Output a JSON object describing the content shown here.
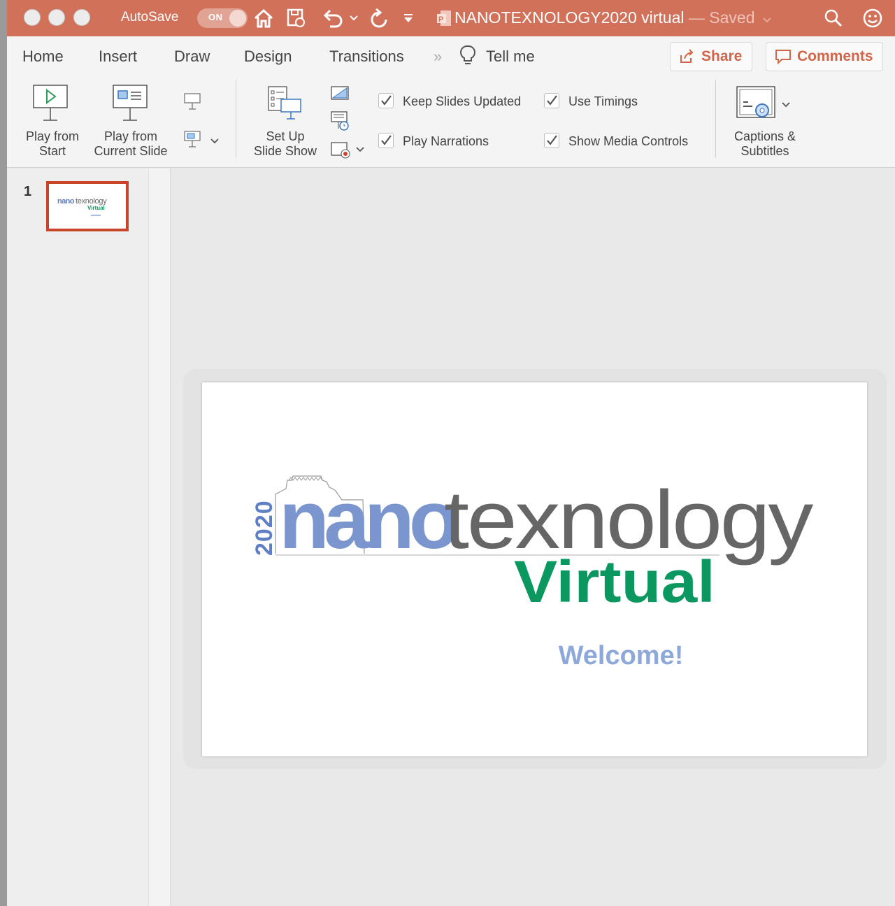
{
  "window": {
    "autosave_label": "AutoSave",
    "autosave_state": "ON",
    "document_title": "NANOTEXNOLOGY2020 virtual",
    "save_status": "— Saved"
  },
  "ribbon": {
    "tabs": [
      "Home",
      "Insert",
      "Draw",
      "Design",
      "Transitions"
    ],
    "overflow_glyph": "»",
    "tell_me": "Tell me",
    "share_label": "Share",
    "comments_label": "Comments",
    "play_from_start": [
      "Play from",
      "Start"
    ],
    "play_from_current": [
      "Play from",
      "Current Slide"
    ],
    "set_up_slide_show": [
      "Set Up",
      "Slide Show"
    ],
    "checkboxes": [
      {
        "label": "Keep Slides Updated",
        "checked": true
      },
      {
        "label": "Use Timings",
        "checked": true
      },
      {
        "label": "Play Narrations",
        "checked": true
      },
      {
        "label": "Show Media Controls",
        "checked": true
      }
    ],
    "captions": [
      "Captions &",
      "Subtitles"
    ]
  },
  "thumbnails": {
    "slide_number": "1"
  },
  "slide": {
    "year": "2020",
    "brand_nano": "nano",
    "brand_tex": "texnology",
    "virtual": "Virtual",
    "welcome": "Welcome!"
  },
  "colors": {
    "titlebar": "#d2715a",
    "accent_orange": "#d2664b",
    "nano_blue": "#7b96cf",
    "nano_dark_blue": "#4666b4",
    "tex_gray": "#666666",
    "virtual_green": "#0b9860",
    "welcome_blue": "#8ea9d9"
  }
}
